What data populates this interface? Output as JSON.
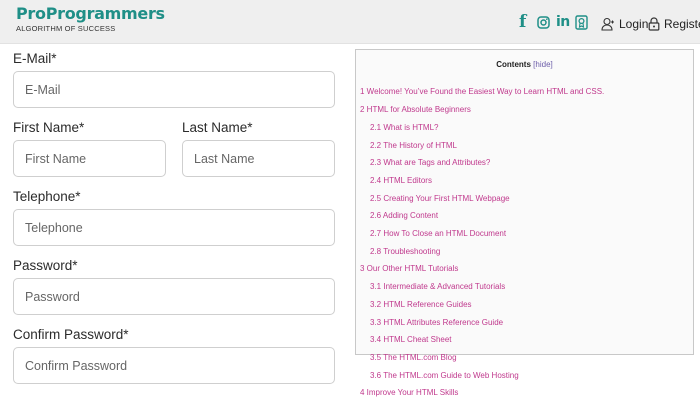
{
  "header": {
    "logo_title": "ProProgrammers",
    "logo_tagline": "ALGORITHM OF SUCCESS",
    "social_facebook": "f",
    "social_linkedin": "in",
    "login_label": "Login",
    "register_label": "Register",
    "brand_color": "#1f8f87"
  },
  "form": {
    "email": {
      "label": "E-Mail*",
      "placeholder": "E-Mail"
    },
    "first_name": {
      "label": "First Name*",
      "placeholder": "First Name"
    },
    "last_name": {
      "label": "Last Name*",
      "placeholder": "Last Name"
    },
    "telephone": {
      "label": "Telephone*",
      "placeholder": "Telephone"
    },
    "password": {
      "label": "Password*",
      "placeholder": "Password"
    },
    "confirm_password": {
      "label": "Confirm Password*",
      "placeholder": "Confirm Password"
    }
  },
  "toc": {
    "title": "Contents",
    "hide_bracket_open": "[",
    "hide_label": "hide",
    "hide_bracket_close": "]",
    "link_color": "#c0398d",
    "items": [
      "1 Welcome! You’ve Found the Easiest Way to Learn HTML and CSS.",
      "2 HTML for Absolute Beginners",
      "2.1 What is HTML?",
      "2.2 The History of HTML",
      "2.3 What are Tags and Attributes?",
      "2.4 HTML Editors",
      "2.5 Creating Your First HTML Webpage",
      "2.6 Adding Content",
      "2.7 How To Close an HTML Document",
      "2.8 Troubleshooting",
      "3 Our Other HTML Tutorials",
      "3.1 Intermediate & Advanced Tutorials",
      "3.2 HTML Reference Guides",
      "3.3 HTML Attributes Reference Guide",
      "3.4 HTML Cheat Sheet",
      "3.5 The HTML.com Blog",
      "3.6 The HTML.com Guide to Web Hosting",
      "4 Improve Your HTML Skills"
    ]
  }
}
